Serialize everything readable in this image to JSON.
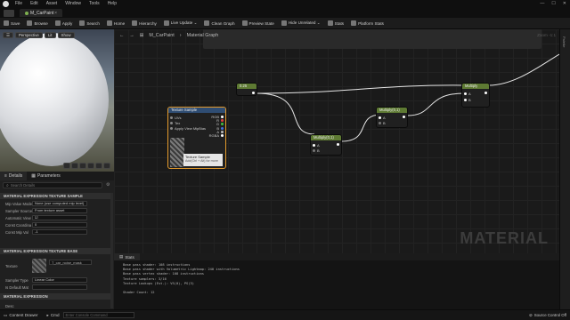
{
  "menu": [
    "File",
    "Edit",
    "Asset",
    "Window",
    "Tools",
    "Help"
  ],
  "tab": {
    "label": "M_CarPaint",
    "close": "×"
  },
  "toolbar": [
    {
      "icon": "save-icon",
      "label": "Save"
    },
    {
      "icon": "browse-icon",
      "label": "Browse"
    },
    {
      "icon": "apply-icon",
      "label": "Apply"
    },
    {
      "icon": "search-icon",
      "label": "Search"
    },
    {
      "icon": "home-icon",
      "label": "Home"
    },
    {
      "icon": "hierarchy-icon",
      "label": "Hierarchy"
    },
    {
      "icon": "live-update-icon",
      "label": "Live Update ⌄"
    },
    {
      "icon": "clean-graph-icon",
      "label": "Clean Graph"
    },
    {
      "icon": "preview-state-icon",
      "label": "Preview State"
    },
    {
      "icon": "hide-unrelated-icon",
      "label": "Hide Unrelated ⌄"
    },
    {
      "icon": "stats-icon",
      "label": "Stats"
    },
    {
      "icon": "platform-stats-icon",
      "label": "Platform Stats"
    }
  ],
  "viewport": {
    "perspective": "Perspective",
    "lit": "Lit",
    "show": "Show"
  },
  "details": {
    "tabs": [
      "Details",
      "Parameters"
    ],
    "search_placeholder": "Search Details",
    "section1": "MATERIAL EXPRESSION TEXTURE SAMPLE",
    "props1": [
      {
        "label": "Mip Value Mode",
        "value": "None (use computed mip level)"
      },
      {
        "label": "Sampler Source",
        "value": "From texture asset"
      },
      {
        "label": "Automatic View",
        "value": "☑"
      },
      {
        "label": "Const Coordina",
        "value": "0"
      },
      {
        "label": "Const Mip Val",
        "value": "-1"
      }
    ],
    "section2": "MATERIAL EXPRESSION TEXTURE BASE",
    "texture_label": "Texture",
    "texture_value": "T_car_noise_mask",
    "props2": [
      {
        "label": "Sampler Type",
        "value": "Linear Color"
      },
      {
        "label": "Is Default Mat",
        "value": ""
      }
    ],
    "section3": "MATERIAL EXPRESSION",
    "desc_label": "Desc"
  },
  "graph": {
    "breadcrumb_root": "M_CarPaint",
    "breadcrumb_sep": "›",
    "breadcrumb_leaf": "Material Graph",
    "zoom": "Zoom -1:1",
    "watermark": "MATERIAL",
    "nodes": {
      "const": "0.25",
      "texture_sample": "Texture Sample",
      "multiply1": "Multiply(0,1)",
      "multiply2": "Multiply(0,1)",
      "multiply3": "Multiply"
    },
    "tex_pins": [
      "UVs",
      "Tex",
      "Apply View MipBias"
    ],
    "tex_out_pins": [
      "RGB",
      "R",
      "G",
      "B",
      "A",
      "RGBA"
    ],
    "tooltip_title": "Texture Sample",
    "tooltip_sub": "Add(Ctrl + Alt) for more"
  },
  "stats": {
    "tab": "Stats",
    "lines": [
      "Base pass shader: 108 instructions",
      "Base pass shader with Volumetric Lightmap: 240 instructions",
      "Base pass vertex shader: 108 instructions",
      "Texture samplers: 3/16",
      "Texture Lookups (Est.): VS(0), PS(3)",
      "",
      "Shader Count: 12"
    ]
  },
  "status": {
    "content_drawer": "Content Drawer",
    "cmd": "Cmd",
    "cmd_placeholder": "Enter Console Command",
    "source_control": "Source Control Off"
  }
}
